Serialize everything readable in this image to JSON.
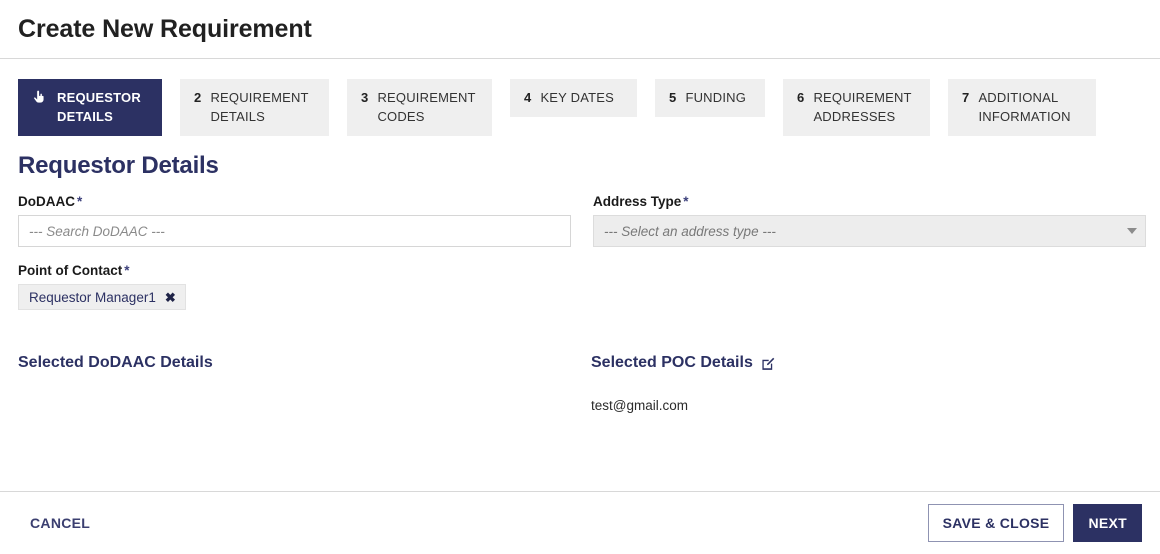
{
  "header": {
    "title": "Create New Requirement"
  },
  "stepper": {
    "tabs": [
      {
        "num": "1",
        "label": "REQUESTOR\nDETAILS",
        "active": true,
        "icon": "hand-pointer-icon"
      },
      {
        "num": "2",
        "label": "REQUIREMENT\nDETAILS",
        "active": false
      },
      {
        "num": "3",
        "label": "REQUIREMENT\nCODES",
        "active": false
      },
      {
        "num": "4",
        "label": "KEY DATES",
        "active": false
      },
      {
        "num": "5",
        "label": "FUNDING",
        "active": false
      },
      {
        "num": "6",
        "label": "REQUIREMENT\nADDRESSES",
        "active": false
      },
      {
        "num": "7",
        "label": "ADDITIONAL\nINFORMATION",
        "active": false
      }
    ]
  },
  "form": {
    "section_title": "Requestor Details",
    "dodaac": {
      "label": "DoDAAC",
      "required_mark": "*",
      "placeholder": "--- Search DoDAAC ---",
      "value": ""
    },
    "address_type": {
      "label": "Address Type",
      "required_mark": "*",
      "placeholder": "--- Select an address type ---",
      "selected": "",
      "options": []
    },
    "point_of_contact": {
      "label": "Point of Contact",
      "required_mark": "*",
      "chips": [
        {
          "label": "Requestor Manager1",
          "remove": "✖"
        }
      ]
    }
  },
  "details": {
    "dodaac_panel": {
      "heading": "Selected DoDAAC Details",
      "body": ""
    },
    "poc_panel": {
      "heading": "Selected POC Details",
      "edit_icon": "edit-square-icon",
      "body": "test@gmail.com"
    }
  },
  "footer": {
    "cancel_label": "CANCEL",
    "save_close_label": "SAVE & CLOSE",
    "next_label": "NEXT"
  },
  "colors": {
    "brand_navy": "#2c3163",
    "tab_inactive_bg": "#efefef",
    "divider": "#d8d8d8",
    "text_dark": "#212121",
    "placeholder": "#808080"
  }
}
